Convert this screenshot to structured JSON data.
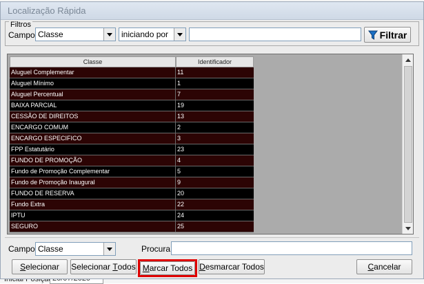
{
  "background": {
    "bottom_label": "Inicial Posição:",
    "bottom_value": "20/07/2020"
  },
  "dialog": {
    "title": "Localização Rápida"
  },
  "filters": {
    "legend": "Filtros",
    "campo_label": "Campo:",
    "campo_value": "Classe",
    "operator_value": "iniciando por",
    "search_value": "",
    "filter_button": "Filtrar"
  },
  "grid": {
    "columns": [
      "Classe",
      "Identificador"
    ],
    "rows": [
      {
        "classe": "Aluguel Complementar",
        "id": "11"
      },
      {
        "classe": "Aluguel Mínimo",
        "id": "1"
      },
      {
        "classe": "Aluguel Percentual",
        "id": "7"
      },
      {
        "classe": "BAIXA PARCIAL",
        "id": "19"
      },
      {
        "classe": "CESSÃO DE DIREITOS",
        "id": "13"
      },
      {
        "classe": "ENCARGO COMUM",
        "id": "2"
      },
      {
        "classe": "ENCARGO ESPECIFICO",
        "id": "3"
      },
      {
        "classe": "FPP Estatutário",
        "id": "23"
      },
      {
        "classe": "FUNDO DE PROMOÇÃO",
        "id": "4"
      },
      {
        "classe": "Fundo de Promoção Complementar",
        "id": "5"
      },
      {
        "classe": "Fundo de Promoção Inaugural",
        "id": "9"
      },
      {
        "classe": "FUNDO DE RESERVA",
        "id": "20"
      },
      {
        "classe": "Fundo Extra",
        "id": "22"
      },
      {
        "classe": "IPTU",
        "id": "24"
      },
      {
        "classe": "SEGURO",
        "id": "25"
      }
    ]
  },
  "search": {
    "campo_label": "Campo:",
    "campo_value": "Classe",
    "procura_label": "Procura:",
    "procura_value": ""
  },
  "buttons": {
    "selecionar": {
      "accel": "S",
      "rest": "elecionar"
    },
    "selecionar_todos": {
      "pre": "Selecionar ",
      "accel": "T",
      "rest": "odos"
    },
    "marcar_todos": {
      "accel": "M",
      "rest": "arcar Todos"
    },
    "desmarcar_todos": {
      "accel": "D",
      "rest": "esmarcar Todos"
    },
    "cancelar": {
      "accel": "C",
      "rest": "ancelar"
    }
  },
  "colors": {
    "row_odd": "#2c0404",
    "row_even": "#000000",
    "highlight": "#e00000"
  }
}
